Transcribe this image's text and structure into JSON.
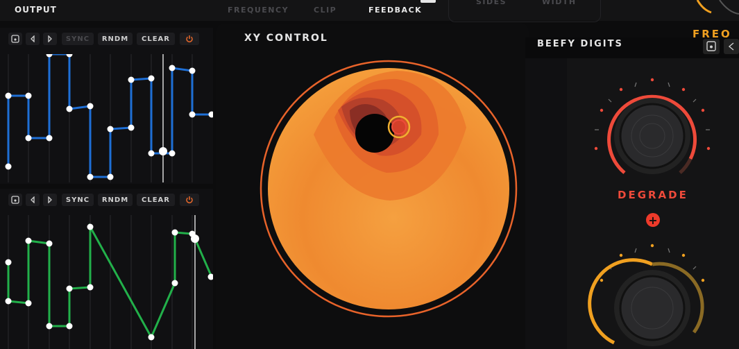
{
  "header": {
    "output_label": "OUTPUT",
    "tabs": [
      "FREQUENCY",
      "CLIP",
      "FEEDBACK"
    ],
    "right_tabs": [
      "SIDES",
      "WIDTH"
    ],
    "freq_label": "FREQ"
  },
  "sequencers": [
    {
      "buttons": [
        "SYNC",
        "RNDM",
        "CLEAR"
      ],
      "color": "#1e6fd6"
    },
    {
      "buttons": [
        "SYNC",
        "RNDM",
        "CLEAR"
      ],
      "color": "#22b04a"
    }
  ],
  "xy_control": {
    "title": "XY CONTROL"
  },
  "beefy_digits": {
    "title": "BEEFY DIGITS",
    "knob_label": "DEGRADE"
  },
  "colors": {
    "accent": "#ee4a3a",
    "orange": "#f0a020",
    "bg": "#0c0c0d"
  }
}
